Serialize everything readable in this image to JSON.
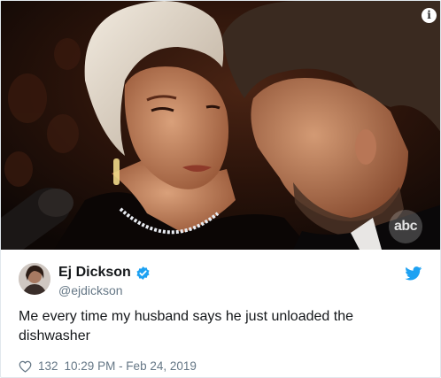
{
  "media": {
    "info_icon": "info-icon",
    "watermark": "abc"
  },
  "tweet": {
    "display_name": "Ej Dickson",
    "handle": "@ejdickson",
    "text": "Me every time my husband says he just unloaded the dishwasher",
    "like_count": "132",
    "timestamp": "10:29 PM - Feb 24, 2019",
    "verified_icon": "verified-badge-icon",
    "brand_icon": "twitter-bird-icon",
    "like_icon": "heart-icon"
  },
  "colors": {
    "twitter_blue": "#1da1f2",
    "secondary_text": "#657786",
    "primary_text": "#14171a"
  }
}
